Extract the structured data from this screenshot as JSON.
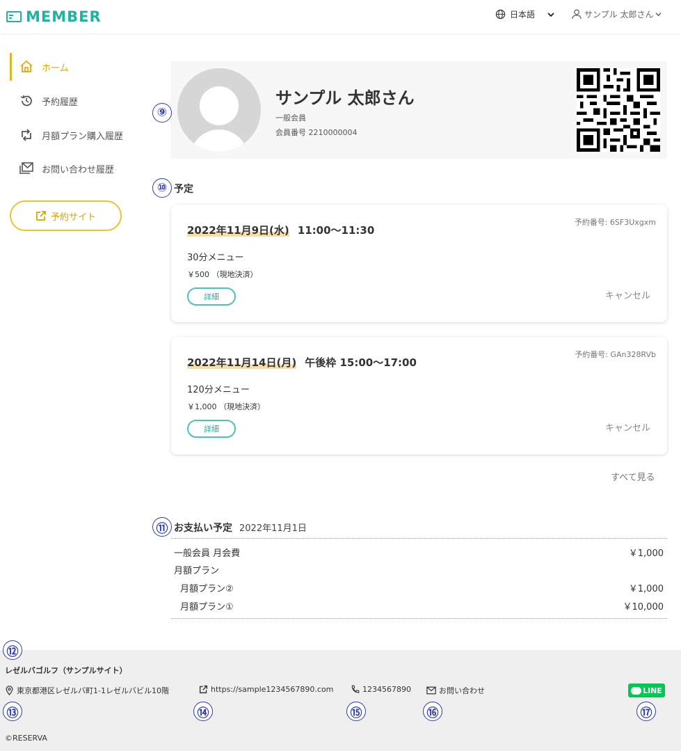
{
  "header": {
    "logo": "MEMBER",
    "language": "日本語",
    "user": "サンプル 太郎さん"
  },
  "sidebar": {
    "items": [
      {
        "label": "ホーム",
        "icon": "home-icon",
        "active": true
      },
      {
        "label": "予約履歴",
        "icon": "history-icon"
      },
      {
        "label": "月額プラン購入履歴",
        "icon": "repeat-icon"
      },
      {
        "label": "お問い合わせ履歴",
        "icon": "mail-stack-icon"
      }
    ],
    "reserve_button": "予約サイト"
  },
  "markers": [
    "⑨",
    "⑩",
    "⑪",
    "⑫",
    "⑬",
    "⑭",
    "⑮",
    "⑯",
    "⑰"
  ],
  "profile": {
    "name": "サンプル 太郎さん",
    "member_type": "一般会員",
    "member_number": "会員番号 2210000004"
  },
  "schedule": {
    "title": "予定",
    "cards": [
      {
        "booking_no": "予約番号: 6SF3Uxgxm",
        "date": "2022年11月9日(水)",
        "time": "11:00～11:30",
        "menu": "30分メニュー",
        "price": "￥500 （現地決済）",
        "detail": "詳細",
        "cancel": "キャンセル"
      },
      {
        "booking_no": "予約番号: GAn328RVb",
        "date": "2022年11月14日(月)",
        "time": "午後枠 15:00～17:00",
        "menu": "120分メニュー",
        "price": "￥1,000 （現地決済）",
        "detail": "詳細",
        "cancel": "キャンセル"
      }
    ],
    "see_all": "すべて見る"
  },
  "payment": {
    "title": "お支払い予定",
    "date": "2022年11月1日",
    "rows": [
      {
        "label": "一般会員 月会費",
        "amount": "￥1,000"
      },
      {
        "label": "月額プラン",
        "amount": ""
      },
      {
        "label": "月額プラン②",
        "amount": "￥1,000"
      },
      {
        "label": "月額プラン①",
        "amount": "￥10,000"
      }
    ]
  },
  "footer": {
    "name": "レゼルバゴルフ（サンプルサイト）",
    "address": "東京都港区レゼルバ町1-1レゼルバビル10階",
    "url": "https://sample1234567890.com",
    "phone": "1234567890",
    "contact": "お問い合わせ",
    "line": "LINE",
    "copyright": "©RESERVA"
  },
  "colors": {
    "brand": "#1fb3a3",
    "accent": "#e8b623",
    "marker": "#2f3fae",
    "line": "#06c755"
  }
}
